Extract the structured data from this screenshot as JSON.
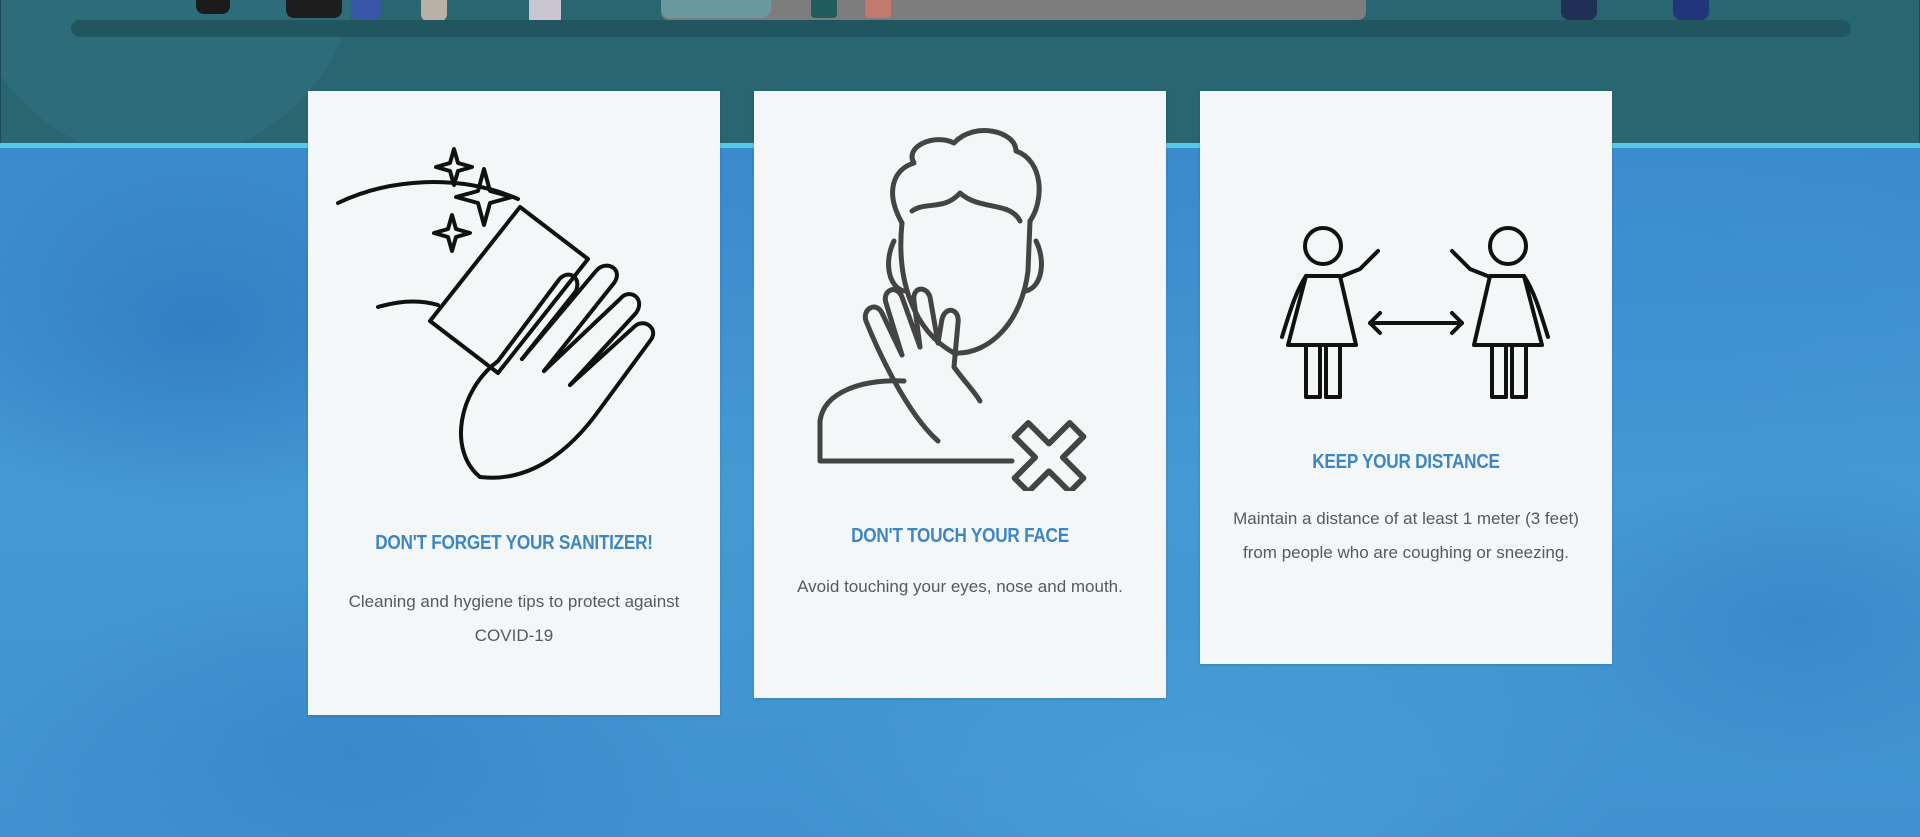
{
  "cards": [
    {
      "icon": "sanitizer-hand-icon",
      "title": "DON'T FORGET YOUR SANITIZER!",
      "text": "Cleaning and hygiene tips to protect against COVID-19"
    },
    {
      "icon": "no-face-touch-icon",
      "title": "DON'T TOUCH YOUR FACE",
      "text": "Avoid touching your eyes, nose and mouth."
    },
    {
      "icon": "social-distance-icon",
      "title": "KEEP YOUR DISTANCE",
      "text": "Maintain a distance of at least 1 meter (3 feet) from people who are coughing or sneezing."
    }
  ],
  "colors": {
    "title": "#3e86c2",
    "body_text": "#555a60",
    "card_bg": "#f3f7f7",
    "hero_bg": "#2a6672",
    "accent_line": "#56c9e8",
    "page_bg": "#3e8fcb"
  }
}
